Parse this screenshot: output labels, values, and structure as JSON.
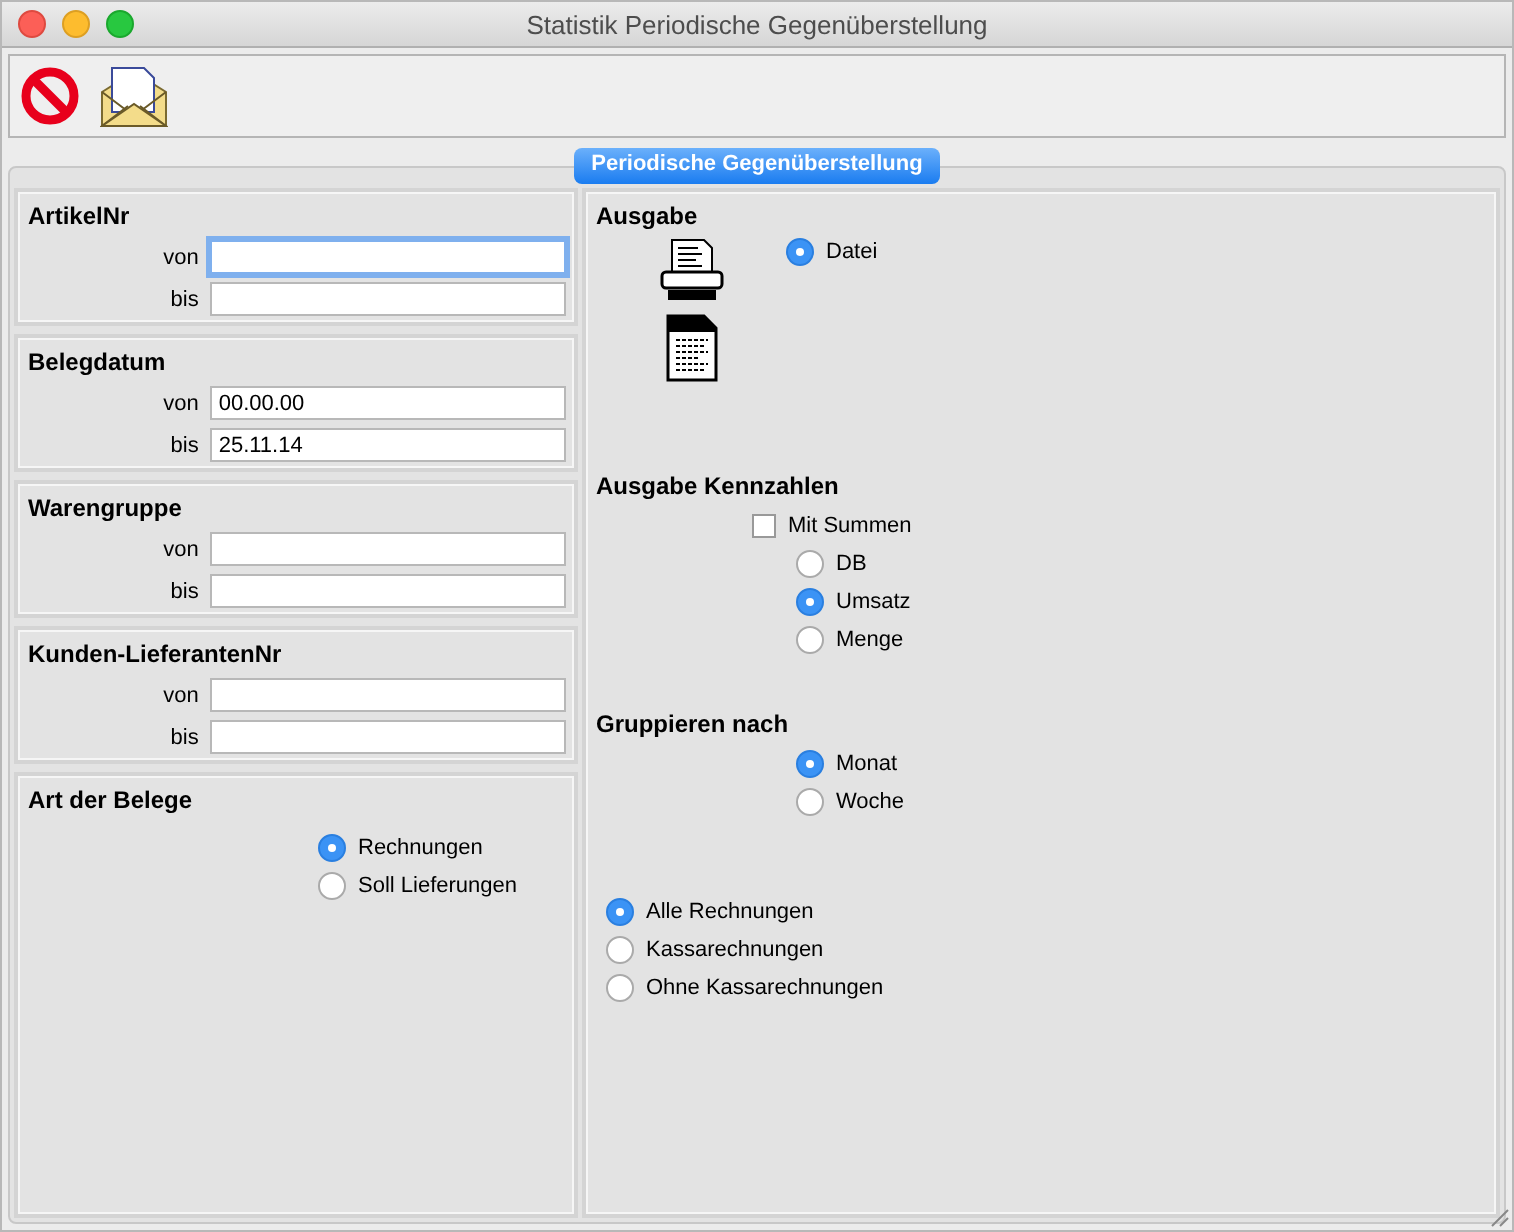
{
  "window": {
    "title": "Statistik Periodische Gegenüberstellung"
  },
  "tabs": [
    {
      "label": "Periodische Gegenüberstellung",
      "selected": true
    }
  ],
  "left_groups": [
    {
      "title": "ArtikelNr",
      "kind": "range",
      "fields": [
        {
          "label": "von",
          "focused": true
        },
        {
          "label": "bis",
          "focused": false
        }
      ]
    },
    {
      "title": "Belegdatum",
      "kind": "range",
      "fields": [
        {
          "label": "von",
          "value": "00.00.00",
          "focused": false
        },
        {
          "label": "bis",
          "value": "25.11.14",
          "focused": false
        }
      ]
    },
    {
      "title": "Warengruppe",
      "kind": "range",
      "fields": [
        {
          "label": "von",
          "focused": false
        },
        {
          "label": "bis",
          "focused": false
        }
      ]
    },
    {
      "title": "Kunden-LieferantenNr",
      "kind": "range",
      "fields": [
        {
          "label": "von",
          "focused": false
        },
        {
          "label": "bis",
          "focused": false
        }
      ]
    },
    {
      "title": "Art der Belege",
      "kind": "radios",
      "options": [
        {
          "label": "Rechnungen",
          "selected": true
        },
        {
          "label": "Soll Lieferungen",
          "selected": false
        }
      ]
    }
  ],
  "ausgabe": {
    "title": "Ausgabe",
    "options": [
      {
        "label": "Datei",
        "selected": true
      }
    ]
  },
  "kennzahlen": {
    "title": "Ausgabe Kennzahlen",
    "checkbox": {
      "label": "Mit Summen",
      "checked": false
    },
    "options": [
      {
        "label": "DB",
        "selected": false
      },
      {
        "label": "Umsatz",
        "selected": true
      },
      {
        "label": "Menge",
        "selected": false
      }
    ]
  },
  "gruppieren": {
    "title": "Gruppieren nach",
    "options": [
      {
        "label": "Monat",
        "selected": true
      },
      {
        "label": "Woche",
        "selected": false
      }
    ]
  },
  "belegfilter": {
    "options": [
      {
        "label": "Alle Rechnungen",
        "selected": true
      },
      {
        "label": "Kassarechnungen",
        "selected": false
      },
      {
        "label": "Ohne Kassarechnungen",
        "selected": false
      }
    ]
  }
}
